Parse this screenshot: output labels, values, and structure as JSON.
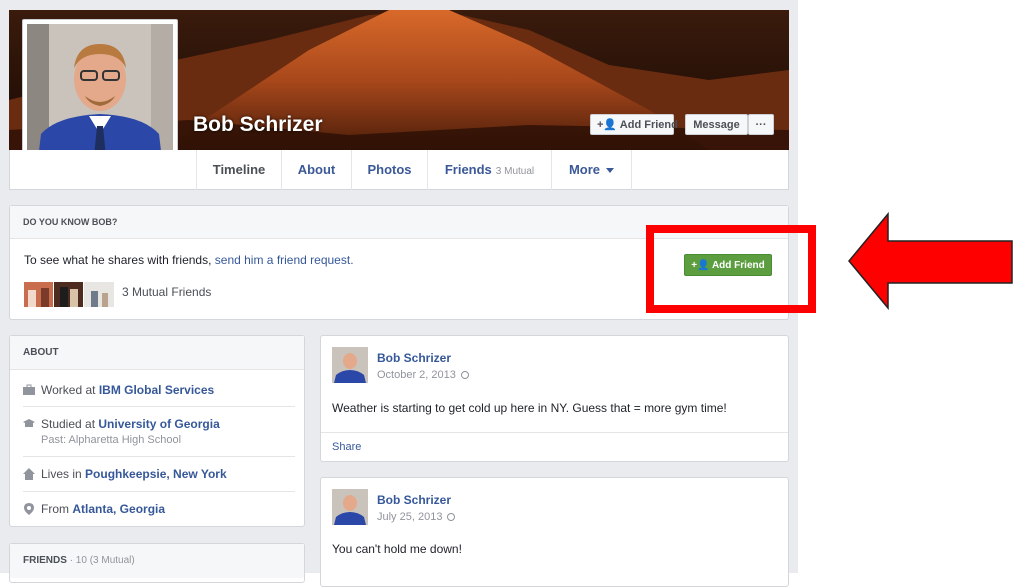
{
  "profile": {
    "name": "Bob Schrizer",
    "add_friend": "Add Friend",
    "message": "Message",
    "more_dots": "···"
  },
  "nav": {
    "tabs": [
      {
        "label": "Timeline"
      },
      {
        "label": "About"
      },
      {
        "label": "Photos"
      },
      {
        "label": "Friends",
        "sub": "3 Mutual"
      },
      {
        "label": "More"
      }
    ]
  },
  "know": {
    "heading": "DO YOU KNOW BOB?",
    "text": "To see what he shares with friends,",
    "link": "send him a friend request.",
    "mutual": "3 Mutual Friends",
    "button": "Add Friend"
  },
  "about": {
    "heading": "ABOUT",
    "items": [
      {
        "icon": "briefcase-icon",
        "prefix": "Worked at",
        "value": "IBM Global Services"
      },
      {
        "icon": "graduation-cap-icon",
        "prefix": "Studied at",
        "value": "University of Georgia",
        "sub": "Past: Alpharetta High School"
      },
      {
        "icon": "home-icon",
        "prefix": "Lives in",
        "value": "Poughkeepsie, New York"
      },
      {
        "icon": "location-pin-icon",
        "prefix": "From",
        "value": "Atlanta, Georgia"
      }
    ]
  },
  "friends": {
    "heading": "FRIENDS",
    "count": "· 10 (3 Mutual)"
  },
  "posts": [
    {
      "author": "Bob Schrizer",
      "date": "October 2, 2013",
      "text": "Weather is starting to get cold up here in NY. Guess that = more gym time!",
      "share": "Share"
    },
    {
      "author": "Bob Schrizer",
      "date": "July 25, 2013",
      "text": "You can't hold me down!"
    }
  ],
  "colors": {
    "brand_link": "#365899",
    "green_button": "#5b9d3f",
    "highlight_red": "#ff0000",
    "page_bg": "#e9ebee"
  }
}
